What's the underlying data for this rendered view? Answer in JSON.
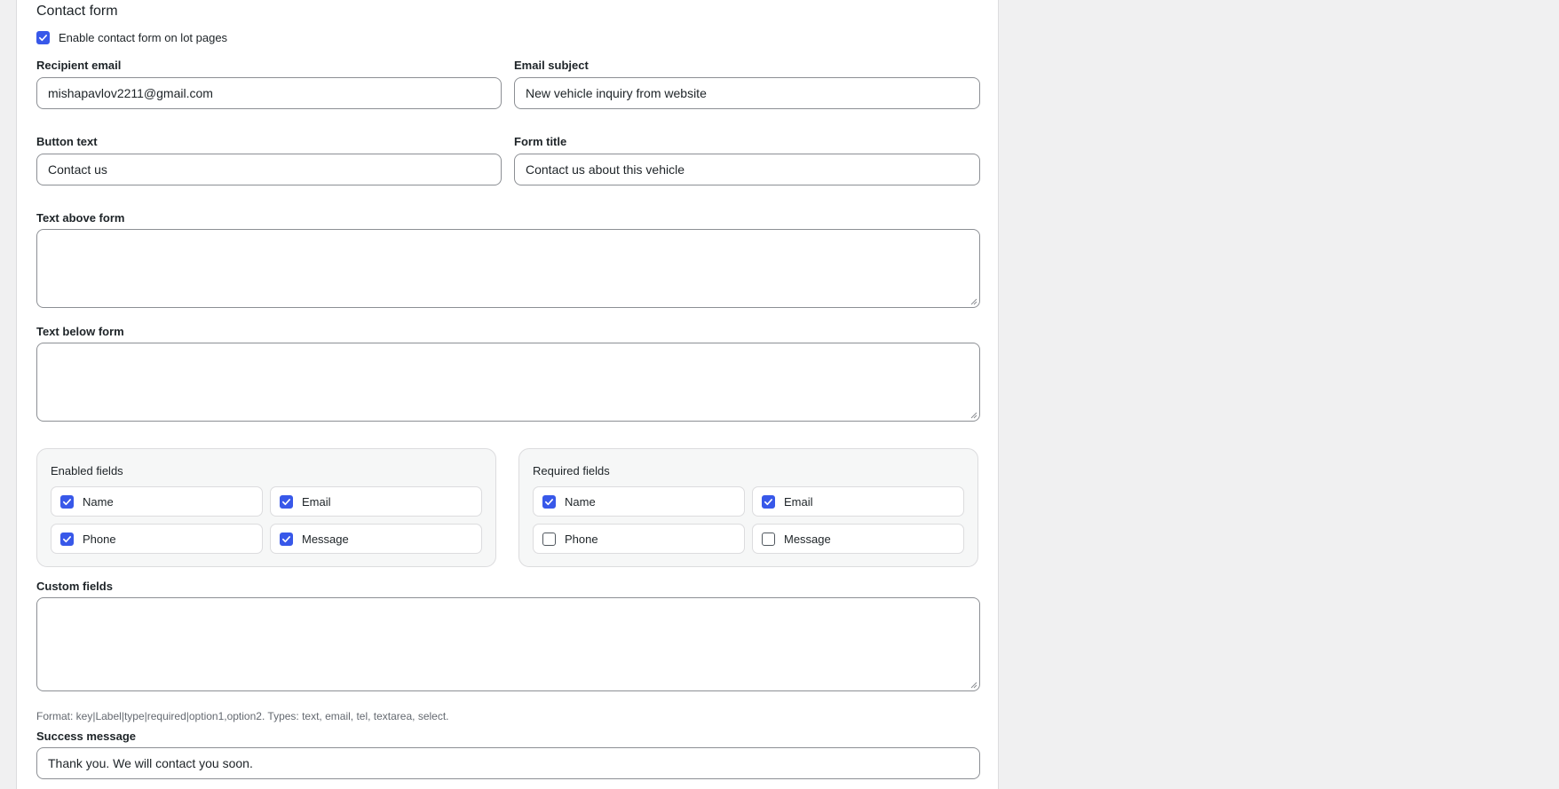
{
  "section": {
    "title": "Contact form"
  },
  "enable": {
    "label": "Enable contact form on lot pages",
    "checked": true
  },
  "recipient": {
    "label": "Recipient email",
    "value": "mishapavlov2211@gmail.com"
  },
  "subject": {
    "label": "Email subject",
    "value": "New vehicle inquiry from website"
  },
  "button_text": {
    "label": "Button text",
    "value": "Contact us"
  },
  "form_title": {
    "label": "Form title",
    "value": "Contact us about this vehicle"
  },
  "text_above": {
    "label": "Text above form",
    "value": ""
  },
  "text_below": {
    "label": "Text below form",
    "value": ""
  },
  "enabled_fields": {
    "title": "Enabled fields",
    "items": [
      {
        "label": "Name",
        "checked": true
      },
      {
        "label": "Email",
        "checked": true
      },
      {
        "label": "Phone",
        "checked": true
      },
      {
        "label": "Message",
        "checked": true
      }
    ]
  },
  "required_fields": {
    "title": "Required fields",
    "items": [
      {
        "label": "Name",
        "checked": true
      },
      {
        "label": "Email",
        "checked": true
      },
      {
        "label": "Phone",
        "checked": false
      },
      {
        "label": "Message",
        "checked": false
      }
    ]
  },
  "custom_fields": {
    "label": "Custom fields",
    "value": "",
    "hint": "Format: key|Label|type|required|option1,option2. Types: text, email, tel, textarea, select."
  },
  "success": {
    "label": "Success message",
    "value": "Thank you. We will contact you soon."
  },
  "colors": {
    "accent": "#3858e9",
    "border": "#8c8f94",
    "page_bg": "#f0f0f1"
  }
}
